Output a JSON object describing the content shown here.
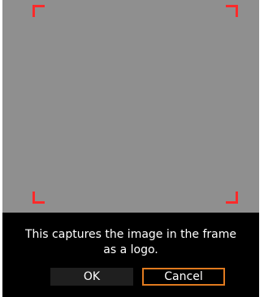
{
  "dialog": {
    "message_line1": "This captures the image in the frame",
    "message_line2": "as a logo.",
    "buttons": {
      "ok": "OK",
      "cancel": "Cancel"
    },
    "focused_button": "cancel"
  },
  "colors": {
    "capture_area": "#8f8f8f",
    "frame_corners": "#ff2a2a",
    "focus_outline": "#e07a1f",
    "dialog_background": "#000000",
    "text": "#ffffff"
  }
}
